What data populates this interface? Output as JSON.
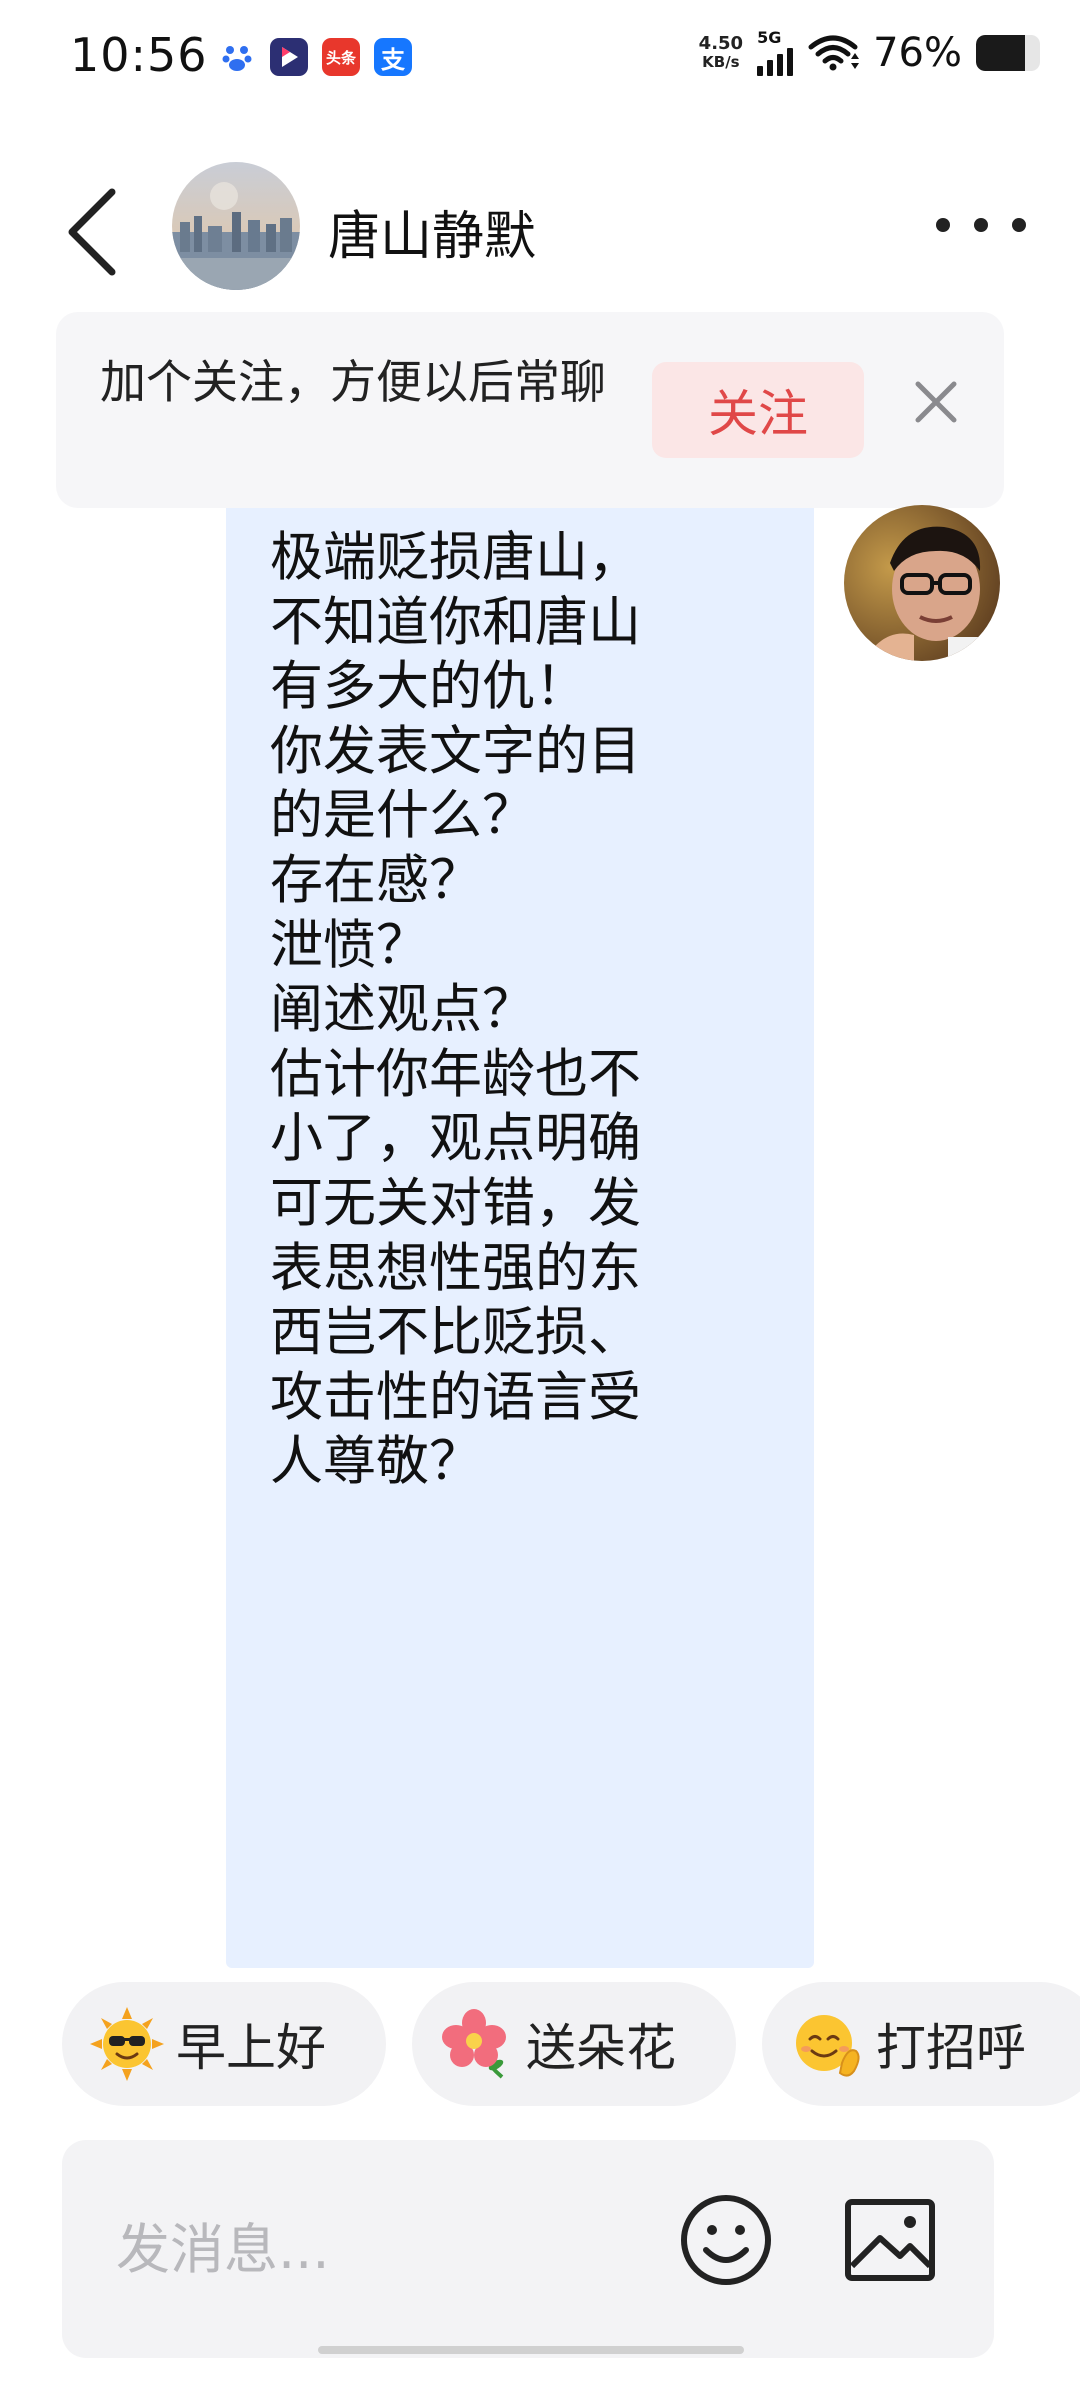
{
  "status_bar": {
    "time": "10:56",
    "app_icons": [
      {
        "name": "baidu-icon",
        "glyph": "🐾",
        "color": "#2f6ff0"
      },
      {
        "name": "video-app-icon",
        "glyph": "▶",
        "color": "#3a3f8f"
      },
      {
        "name": "toutiao-icon",
        "glyph": "头条",
        "color": "#e8372c"
      },
      {
        "name": "alipay-icon",
        "glyph": "支",
        "color": "#1677ff"
      }
    ],
    "net_speed_value": "4.50",
    "net_speed_unit": "KB/s",
    "network_type": "5G",
    "battery_percent": "76%",
    "battery_level": 0.76
  },
  "header": {
    "contact_name": "唐山静默"
  },
  "banner": {
    "text": "加个关注，方便以后常聊",
    "follow_label": "关注"
  },
  "message": {
    "text": "极端贬损唐山，\n不知道你和唐山\n有多大的仇！\n你发表文字的目\n的是什么？\n存在感？\n泄愤？\n阐述观点？\n估计你年龄也不\n小了，观点明确\n可无关对错，发\n表思想性强的东\n西岂不比贬损、\n攻击性的语言受\n人尊敬？"
  },
  "quick_replies": [
    {
      "emoji": "sun-sunglasses-icon",
      "label": "早上好"
    },
    {
      "emoji": "flower-icon",
      "label": "送朵花"
    },
    {
      "emoji": "wave-smile-icon",
      "label": "打招呼"
    }
  ],
  "input": {
    "placeholder": "发消息..."
  },
  "colors": {
    "accent_red": "#e04848",
    "bubble_bg": "#e7f0ff",
    "banner_bg": "#f6f6f8"
  }
}
